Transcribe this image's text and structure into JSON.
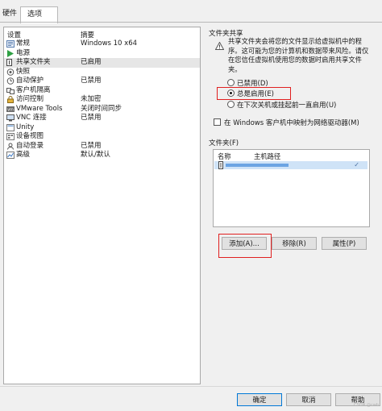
{
  "tabs": [
    {
      "label": "硬件"
    },
    {
      "label": "选项"
    }
  ],
  "device_list": {
    "header": {
      "setting": "设置",
      "summary": "摘要"
    },
    "rows": [
      {
        "name": "常规",
        "summary": "Windows 10 x64",
        "icon": "general-icon"
      },
      {
        "name": "电源",
        "summary": "",
        "icon": "power-icon"
      },
      {
        "name": "共享文件夹",
        "summary": "已启用",
        "icon": "shared-folder-icon"
      },
      {
        "name": "快照",
        "summary": "",
        "icon": "snapshot-icon"
      },
      {
        "name": "自动保护",
        "summary": "已禁用",
        "icon": "autoprotect-icon"
      },
      {
        "name": "客户机隔离",
        "summary": "",
        "icon": "isolation-icon"
      },
      {
        "name": "访问控制",
        "summary": "未加密",
        "icon": "access-control-icon"
      },
      {
        "name": "VMware Tools",
        "summary": "关闭时间同步",
        "icon": "vmware-tools-icon"
      },
      {
        "name": "VNC 连接",
        "summary": "已禁用",
        "icon": "vnc-icon"
      },
      {
        "name": "Unity",
        "summary": "",
        "icon": "unity-icon"
      },
      {
        "name": "设备视图",
        "summary": "",
        "icon": "device-view-icon"
      },
      {
        "name": "自动登录",
        "summary": "已禁用",
        "icon": "autologin-icon"
      },
      {
        "name": "高级",
        "summary": "默认/默认",
        "icon": "advanced-icon"
      }
    ]
  },
  "sharing": {
    "title": "文件夹共享",
    "description": "共享文件夹会将您的文件显示给虚拟机中的程序。这可能为您的计算机和数据带来风险。请仅在您信任虚拟机使用您的数据时启用共享文件夹。",
    "options": [
      {
        "label": "已禁用(D)",
        "selected": false
      },
      {
        "label": "总是启用(E)",
        "selected": true
      },
      {
        "label": "在下次关机或挂起前一直启用(U)",
        "selected": false
      }
    ],
    "map_drive_label": "在 Windows 客户机中映射为网络驱动器(M)",
    "map_drive_checked": false
  },
  "folders": {
    "title": "文件夹(F)",
    "columns": {
      "name": "名称",
      "host_path": "主机路径"
    },
    "add_label": "添加(A)...",
    "remove_label": "移除(R)",
    "properties_label": "属性(P)"
  },
  "footer": {
    "ok_label": "确定",
    "cancel_label": "取消",
    "help_label": "帮助"
  },
  "watermark": "CSDN @cwb"
}
